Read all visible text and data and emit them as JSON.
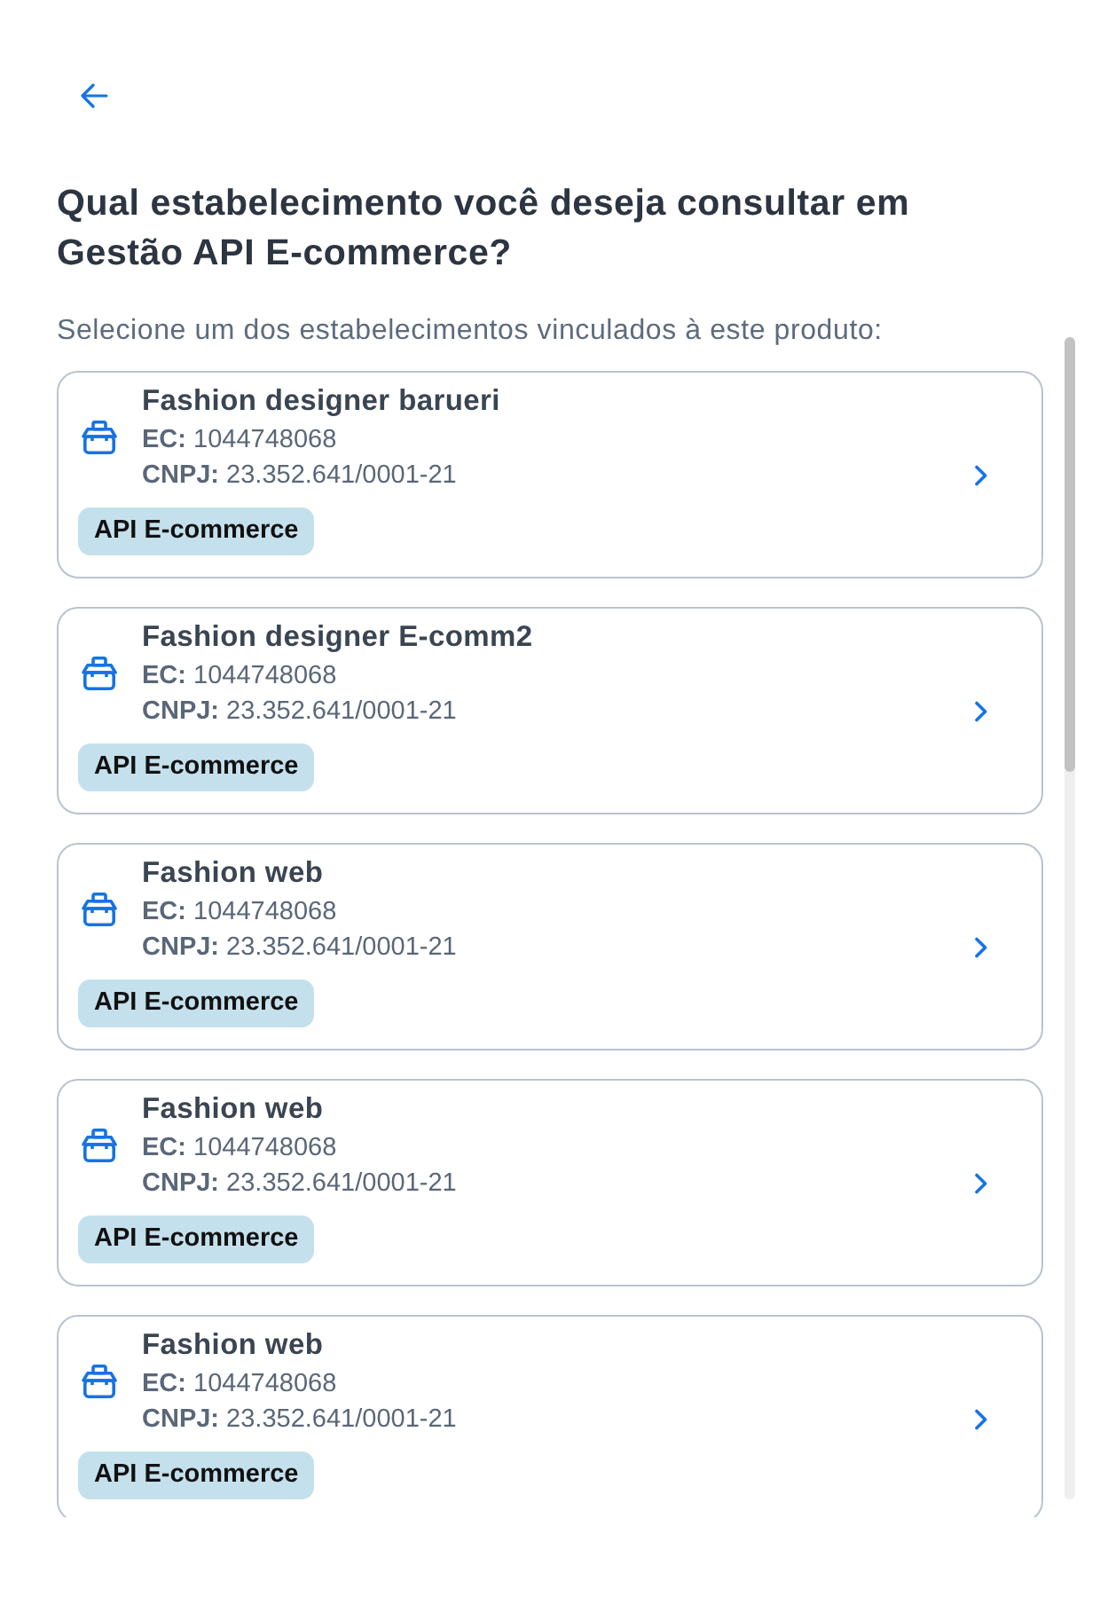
{
  "header": {
    "title": "Qual estabelecimento você deseja consultar em Gestão API E-commerce?",
    "subtitle": "Selecione um dos estabelecimentos vinculados à este produto:"
  },
  "establishments": [
    {
      "name": "Fashion designer barueri",
      "ec": "**EC:** 1044748068",
      "cnpj": "**CNPJ:** 23.352.641/0001-21",
      "tag": "API E-commerce"
    },
    {
      "name": "Fashion designer E-comm2",
      "ec": "**EC:** 1044748068",
      "cnpj": "**CNPJ:** 23.352.641/0001-21",
      "tag": "API E-commerce"
    },
    {
      "name": "Fashion web",
      "ec": "**EC:** 1044748068",
      "cnpj": "**CNPJ:** 23.352.641/0001-21",
      "tag": "API E-commerce"
    },
    {
      "name": "Fashion web",
      "ec": "**EC:** 1044748068",
      "cnpj": "**CNPJ:** 23.352.641/0001-21",
      "tag": "API E-commerce"
    },
    {
      "name": "Fashion web",
      "ec": "**EC:** 1044748068",
      "cnpj": "**CNPJ:** 23.352.641/0001-21",
      "tag": "API E-commerce"
    }
  ]
}
